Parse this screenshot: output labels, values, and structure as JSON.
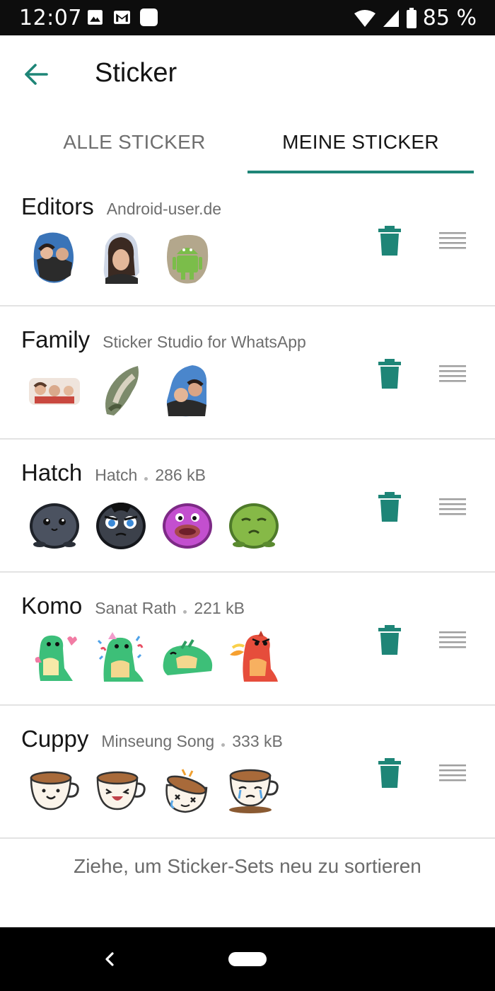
{
  "status_bar": {
    "time": "12:07",
    "battery": "85 %",
    "icons_left": [
      "image-icon",
      "gmail-icon",
      "app-icon"
    ],
    "icons_right": [
      "wifi-icon",
      "signal-icon",
      "battery-icon"
    ]
  },
  "toolbar": {
    "title": "Sticker",
    "back_icon": "arrow-back-icon"
  },
  "tabs": [
    {
      "label": "ALLE STICKER",
      "active": false
    },
    {
      "label": "MEINE STICKER",
      "active": true
    }
  ],
  "packs": [
    {
      "name": "Editors",
      "author": "Android-user.de",
      "size": "",
      "sticker_count": 3
    },
    {
      "name": "Family",
      "author": "Sticker Studio for WhatsApp",
      "size": "",
      "sticker_count": 3
    },
    {
      "name": "Hatch",
      "author": "Hatch",
      "size": "286 kB",
      "sticker_count": 4
    },
    {
      "name": "Komo",
      "author": "Sanat Rath",
      "size": "221 kB",
      "sticker_count": 4
    },
    {
      "name": "Cuppy",
      "author": "Minseung Song",
      "size": "333 kB",
      "sticker_count": 4
    }
  ],
  "footer_hint": "Ziehe, um Sticker-Sets neu zu sortieren",
  "colors": {
    "accent": "#1e8577",
    "divider": "#e3e3e3"
  }
}
